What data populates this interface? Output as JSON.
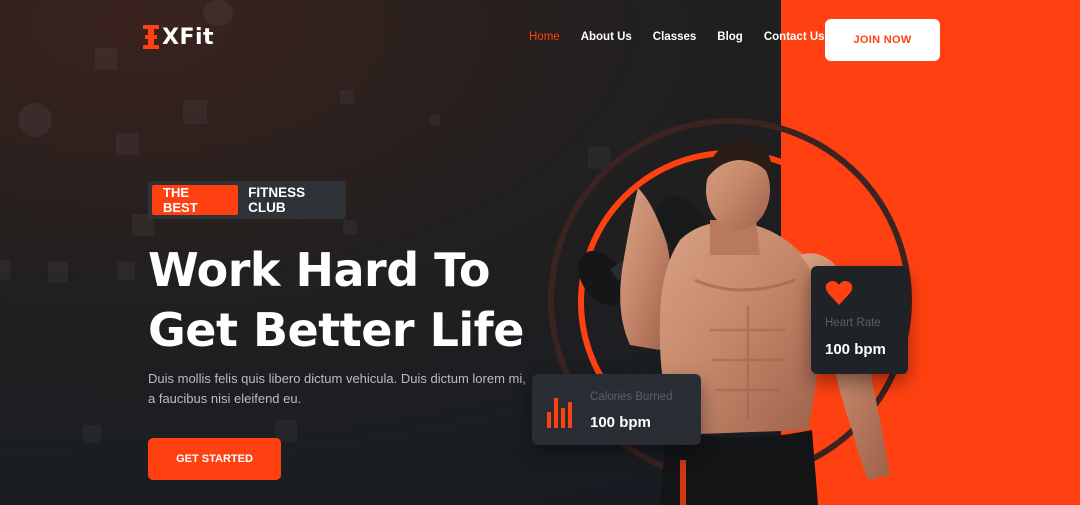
{
  "brand": {
    "name": "XFit",
    "accent": "#ff4111"
  },
  "nav": {
    "items": [
      {
        "label": "Home",
        "active": true
      },
      {
        "label": "About Us"
      },
      {
        "label": "Classes"
      },
      {
        "label": "Blog"
      },
      {
        "label": "Contact Us"
      }
    ],
    "join_label": "JOIN NOW"
  },
  "hero": {
    "tag_highlight": "THE BEST",
    "tag_rest": "FITNESS CLUB",
    "title_line1": "Work Hard To",
    "title_line2": "Get Better Life",
    "description": "Duis mollis felis quis libero dictum vehicula. Duis dictum lorem mi, a faucibus nisi eleifend eu.",
    "cta_label": "GET STARTED"
  },
  "stats": {
    "heart_rate": {
      "label": "Heart Rate",
      "value": "100 bpm",
      "icon": "heart-icon"
    },
    "calories": {
      "label": "Calories Burned",
      "value": "100 bpm",
      "icon": "bar-chart-icon"
    }
  }
}
